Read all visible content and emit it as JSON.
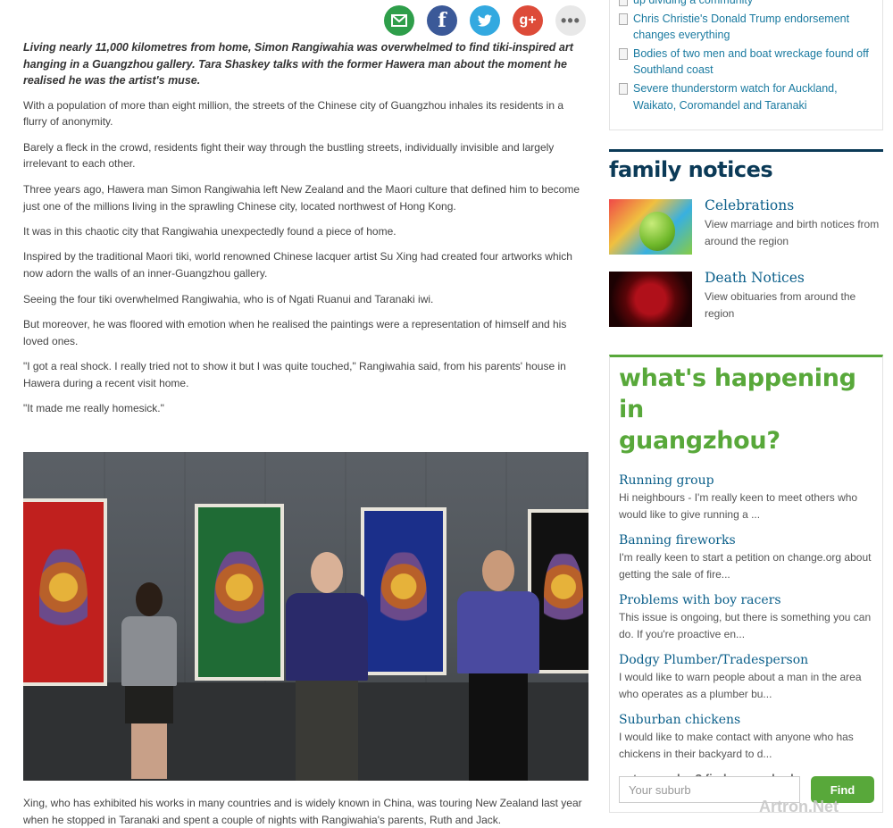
{
  "share": {
    "email_icon": "envelope-icon",
    "facebook_glyph": "f",
    "twitter_icon": "bird-icon",
    "gplus_glyph": "g+",
    "more_glyph": "•••"
  },
  "article": {
    "lede": "Living nearly 11,000 kilometres from home, Simon Rangiwahia was overwhelmed to find tiki-inspired art hanging in a Guangzhou gallery. Tara Shaskey talks with the former Hawera man about the moment he realised he was the artist's muse.",
    "paragraphs": [
      "With a population of more than eight million, the streets of the Chinese city of Guangzhou inhales its residents in a  flurry of anonymity.",
      "Barely a fleck in the crowd,  residents fight their way through the bustling streets, individually invisible and largely irrelevant to each other.",
      "Three years ago, Hawera man Simon Rangiwahia left New Zealand and the Maori culture that defined him to become just one of the millions living in the sprawling Chinese city, located northwest of Hong Kong.",
      "It was in this chaotic city that Rangiwahia unexpectedly found a piece of home.",
      "Inspired by the traditional Maori tiki, world renowned Chinese lacquer artist Su Xing had created four artworks which now adorn the walls of an inner-Guangzhou gallery.",
      "Seeing the four tiki overwhelmed Rangiwahia, who is of Ngati Ruanui and Taranaki iwi.",
      "But moreover, he was floored with emotion when he realised the paintings were a representation of himself and his loved ones.",
      "\"I got a real shock. I really tried not to show it but I was quite touched,\" Rangiwahia said, from his parents' house in Hawera during a recent visit home.",
      "\"It made me really homesick.\""
    ],
    "caption": "Xing, who has exhibited his works in many countries and is widely known in China, was touring New Zealand last year when he stopped in Taranaki and spent a couple of nights with Rangiwahia's parents, Ruth and Jack."
  },
  "sidebar": {
    "latest": [
      "up dividing a community",
      "Chris Christie's Donald Trump endorsement changes everything",
      "Bodies of two men and boat wreckage found off Southland coast",
      "Severe thunderstorm watch for Auckland, Waikato, Coromandel and Taranaki"
    ],
    "family_notices": {
      "heading": "family notices",
      "items": [
        {
          "title": "Celebrations",
          "desc": "View marriage and birth notices from around the region"
        },
        {
          "title": "Death Notices",
          "desc": "View obituaries from around the region"
        }
      ]
    },
    "whats_happening": {
      "heading_line1": "what's happening in",
      "heading_line2": "guangzhou?",
      "posts": [
        {
          "title": "Running group",
          "desc": "Hi neighbours - I'm really keen to meet others who would like to give running a ..."
        },
        {
          "title": "Banning fireworks",
          "desc": "I'm really keen to start a petition on change.org about getting the sale of fire..."
        },
        {
          "title": "Problems with boy racers",
          "desc": "This issue is ongoing, but there is something you can do. If you're proactive en..."
        },
        {
          "title": "Dodgy Plumber/Tradesperson",
          "desc": "I would like to warn people about a man in the area who operates as a plumber bu..."
        },
        {
          "title": "Suburban chickens",
          "desc": "I would like to make contact with anyone who has chickens in their backyard to d..."
        }
      ],
      "member_text": "not a member? find your suburb",
      "suburb_placeholder": "Your suburb",
      "find_label": "Find"
    }
  },
  "watermark": "Artron.Net"
}
